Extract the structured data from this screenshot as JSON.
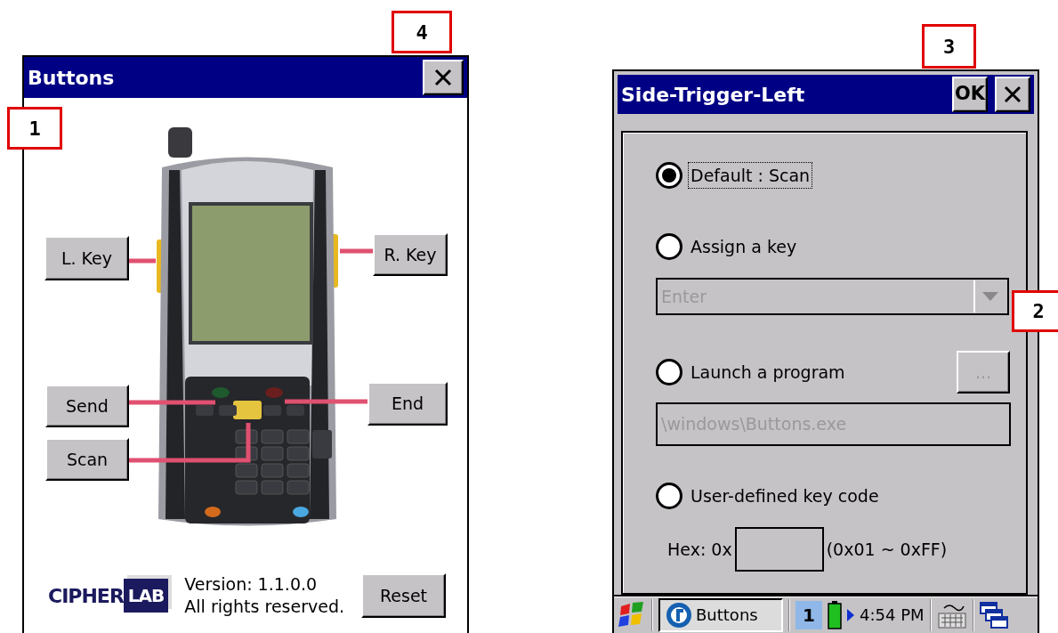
{
  "callouts": [
    {
      "label": "4"
    },
    {
      "label": "1"
    },
    {
      "label": "3"
    },
    {
      "label": "2"
    }
  ],
  "buttons_window": {
    "title": "Buttons",
    "key_buttons": [
      {
        "label": "L. Key"
      },
      {
        "label": "R. Key"
      },
      {
        "label": "Send"
      },
      {
        "label": "End"
      },
      {
        "label": "Scan"
      }
    ],
    "logo": {
      "word": "CIPHER",
      "badge": "LAB"
    },
    "version": "Version: 1.1.0.0",
    "rights": "All rights reserved.",
    "reset": "Reset"
  },
  "trigger_window": {
    "title": "Side-Trigger-Left",
    "ok": "OK",
    "options": [
      {
        "kind": "plain",
        "label": "Default : Scan",
        "selected": true,
        "focused": true
      },
      {
        "kind": "combo",
        "label": "Assign a key",
        "selected": false,
        "focused": false,
        "value": "Enter",
        "disabled": true
      },
      {
        "kind": "program",
        "label": "Launch a program",
        "selected": false,
        "focused": false,
        "browse": "...",
        "value": "\\windows\\Buttons.exe",
        "disabled": true
      },
      {
        "kind": "hex",
        "label": "User-defined key code",
        "selected": false,
        "focused": false,
        "prefix": "Hex: 0x",
        "range": "(0x01 ~ 0xFF)"
      }
    ]
  },
  "taskbar": {
    "task": "Buttons",
    "input_indicator": "1",
    "time": "4:54 PM"
  }
}
